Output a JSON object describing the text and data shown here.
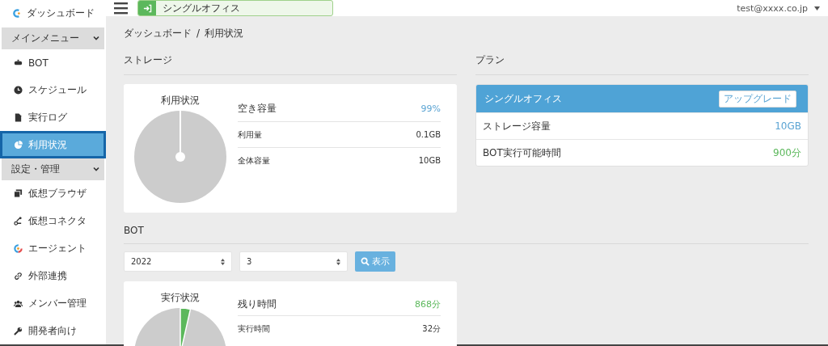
{
  "sidebar": {
    "top_item": {
      "label": "ダッシュボード"
    },
    "sections": [
      {
        "title": "メインメニュー",
        "expanded": true,
        "items": [
          {
            "label": "BOT",
            "selected": false
          },
          {
            "label": "スケジュール",
            "selected": false
          },
          {
            "label": "実行ログ",
            "selected": false
          },
          {
            "label": "利用状況",
            "selected": true
          }
        ]
      },
      {
        "title": "設定・管理",
        "expanded": true,
        "items": [
          {
            "label": "仮想ブラウザ",
            "selected": false
          },
          {
            "label": "仮想コネクタ",
            "selected": false
          },
          {
            "label": "エージェント",
            "selected": false
          },
          {
            "label": "外部連携",
            "selected": false
          },
          {
            "label": "メンバー管理",
            "selected": false
          },
          {
            "label": "開発者向け",
            "selected": false
          }
        ]
      }
    ]
  },
  "header": {
    "plan_badge": "シングルオフィス",
    "user": "test@xxxx.co.jp"
  },
  "breadcrumb": {
    "items": [
      "ダッシュボード",
      "利用状況"
    ],
    "separator": "/"
  },
  "storage": {
    "heading": "ストレージ",
    "chart_title": "利用状況",
    "rows": [
      {
        "kind": "headline",
        "label": "空き容量",
        "value": "99%",
        "color": "#5ba4d3"
      },
      {
        "kind": "detail",
        "label": "利用量",
        "value": "0.1GB"
      },
      {
        "kind": "detail",
        "label": "全体容量",
        "value": "10GB"
      }
    ]
  },
  "plan": {
    "heading": "プラン",
    "name": "シングルオフィス",
    "upgrade_button": "アップグレード",
    "rows": [
      {
        "label": "ストレージ容量",
        "value": "10GB",
        "color": "#5ba4d3"
      },
      {
        "label": "BOT実行可能時間",
        "value": "900分",
        "color": "#5cb85c"
      }
    ]
  },
  "bot": {
    "heading": "BOT",
    "year_select": "2022",
    "month_select": "3",
    "show_button": "表示",
    "chart_title": "実行状況",
    "rows": [
      {
        "kind": "headline",
        "label": "残り時間",
        "value": "868分",
        "color": "#5cb85c"
      },
      {
        "kind": "detail",
        "label": "実行時間",
        "value": "32分"
      }
    ]
  }
}
